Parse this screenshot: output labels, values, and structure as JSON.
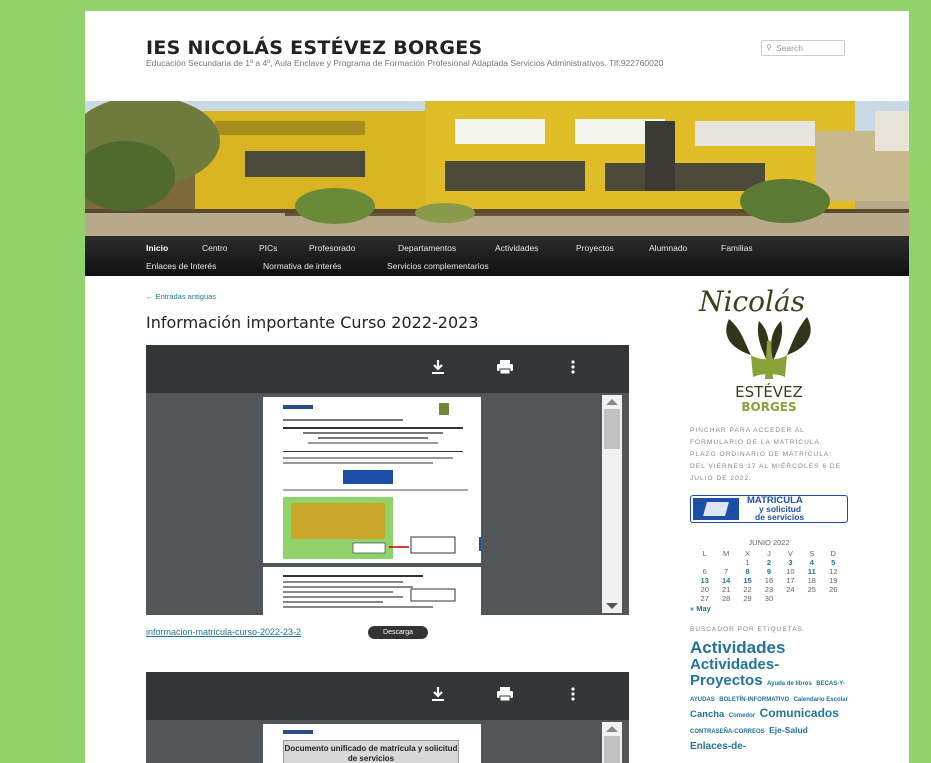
{
  "site": {
    "title": "IES NICOLÁS ESTÉVEZ BORGES",
    "description": "Educación Secundaria de 1º a 4º, Aula Enclave y Programa de Formación Profesional Adaptada Servicios Administrativos. Tlf:922760020"
  },
  "search": {
    "placeholder": "Search",
    "icon": "search-icon"
  },
  "nav": {
    "row1": [
      "Inicio",
      "Centro",
      "PICs",
      "Profesorado",
      "Departamentos",
      "Actividades",
      "Proyectos",
      "Alumnado",
      "Familias"
    ],
    "row2": [
      "Enlaces de Interés",
      "Normativa de interés",
      "Servicios complementarios"
    ],
    "active": "Inicio"
  },
  "post": {
    "older_link": "← Entradas antiguas",
    "title": "Información importante Curso 2022-2023",
    "file_name": "informacion-matricula-curso-2022-23-2",
    "download_label": "Descarga",
    "second_doc_heading": "Documento unificado de matrícula y solicitud de servicios"
  },
  "viewer_icons": [
    "download-icon",
    "print-icon",
    "more-options-icon"
  ],
  "sidebar": {
    "logo": {
      "top": "Nicolás",
      "line1": "ESTÉVEZ",
      "line2": "BORGES"
    },
    "notice": "PINCHAR PARA ACCEDER AL FORMULARIO DE LA MATRÍCULA. PLAZO ORDINARIO DE MATRÍCULA: DEL VIERNES 17 AL MIÉRCOLES 6 DE JULIO DE 2022.",
    "matricula_button": {
      "line1": "MATRÍCULA",
      "line2": "y solicitud",
      "line3": "de servicios"
    },
    "calendar": {
      "caption": "JUNIO 2022",
      "weekdays": [
        "L",
        "M",
        "X",
        "J",
        "V",
        "S",
        "D"
      ],
      "weeks": [
        [
          "",
          "",
          "1",
          "2",
          "3",
          "4",
          "5"
        ],
        [
          "6",
          "7",
          "8",
          "9",
          "10",
          "11",
          "12"
        ],
        [
          "13",
          "14",
          "15",
          "16",
          "17",
          "18",
          "19"
        ],
        [
          "20",
          "21",
          "22",
          "23",
          "24",
          "25",
          "26"
        ],
        [
          "27",
          "28",
          "29",
          "30",
          "",
          "",
          ""
        ]
      ],
      "linked_days": [
        "2",
        "3",
        "4",
        "5",
        "8",
        "9",
        "11",
        "13",
        "14",
        "15"
      ],
      "prev_link": "« May"
    },
    "tags_heading": "BUSCADOR POR ETIQUETAS",
    "tags": [
      {
        "label": "Actividades",
        "size": 17
      },
      {
        "label": "Actividades-Proyectos",
        "size": 15
      },
      {
        "label": "Ayuda de libros",
        "size": 6
      },
      {
        "label": "BECAS-Y-AYUDAS",
        "size": 6
      },
      {
        "label": "BOLETÍN-INFORMATIVO",
        "size": 6
      },
      {
        "label": "Calendario Escolar",
        "size": 6
      },
      {
        "label": "Cancha",
        "size": 9.5
      },
      {
        "label": "Comedor",
        "size": 6
      },
      {
        "label": "Comunicados",
        "size": 12
      },
      {
        "label": "CONTRASEÑA-CORREOS",
        "size": 6
      },
      {
        "label": "Eje-Salud",
        "size": 8.5
      },
      {
        "label": "Enlaces-de-",
        "size": 10
      }
    ]
  },
  "colors": {
    "page_bg": "#8fd36a",
    "link": "#21759b",
    "nav_bg": "#222222",
    "viewer_toolbar": "#323639",
    "accent_blue": "#1d4fa8"
  }
}
